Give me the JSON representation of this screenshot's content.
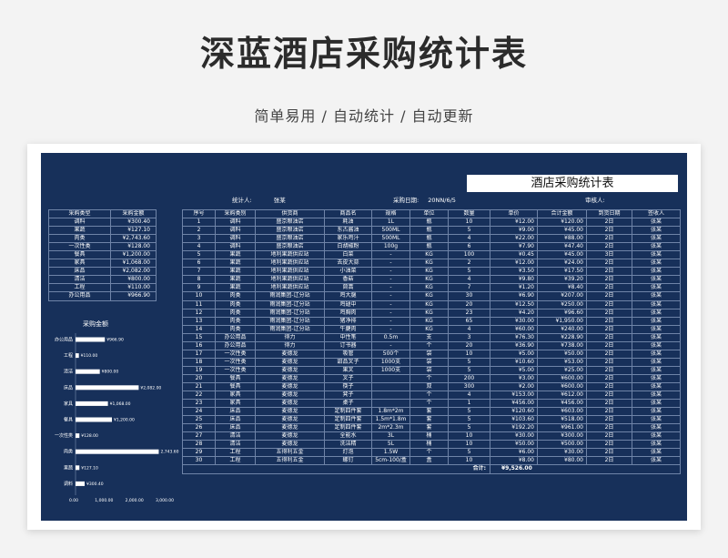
{
  "page": {
    "title": "深蓝酒店采购统计表",
    "subtitle": "简单易用 / 自动统计 / 自动更新"
  },
  "sheet": {
    "title": "酒店采购统计表",
    "stat_label": "统计人:",
    "stat_value": "张某",
    "date_label": "采购日期:",
    "date_value": "20NN/6/5",
    "reviewer_label": "审核人:"
  },
  "summary": {
    "headers": [
      "采购类型",
      "采购金额"
    ],
    "rows": [
      [
        "调料",
        "¥300.40"
      ],
      [
        "果蔬",
        "¥127.10"
      ],
      [
        "肉类",
        "¥2,743.60"
      ],
      [
        "一次性类",
        "¥128.00"
      ],
      [
        "餐具",
        "¥1,200.00"
      ],
      [
        "家具",
        "¥1,068.00"
      ],
      [
        "床品",
        "¥2,082.00"
      ],
      [
        "清洁",
        "¥800.00"
      ],
      [
        "工程",
        "¥110.00"
      ],
      [
        "办公用品",
        "¥966.90"
      ]
    ]
  },
  "chart_data": {
    "type": "bar",
    "title": "采购金额",
    "orientation": "horizontal",
    "categories": [
      "办公用品",
      "工程",
      "清洁",
      "床品",
      "家具",
      "餐具",
      "一次性类",
      "肉类",
      "果蔬",
      "调料"
    ],
    "values": [
      966.9,
      110.0,
      800.0,
      2082.0,
      1068.0,
      1200.0,
      128.0,
      2743.6,
      127.1,
      300.4
    ],
    "value_labels": [
      "¥966.90",
      "¥110.00",
      "¥800.00",
      "¥2,082.00",
      "¥1,068.00",
      "¥1,200.00",
      "¥128.00",
      "2,743.60",
      "¥127.10",
      "¥300.40"
    ],
    "tick_labels": [
      "0.00",
      "1,000.00",
      "2,000.00",
      "3,000.00"
    ],
    "xlim": [
      0,
      3000
    ]
  },
  "main": {
    "headers": [
      "序号",
      "采购类别",
      "供货商",
      "商品名",
      "规格",
      "单位",
      "数量",
      "单价",
      "合计金额",
      "到货日期",
      "签收人"
    ],
    "rows": [
      [
        "1",
        "调料",
        "盛京粮油店",
        "耗油",
        "1L",
        "瓶",
        "10",
        "¥12.00",
        "¥120.00",
        "2日",
        "张某"
      ],
      [
        "2",
        "调料",
        "盛京粮油店",
        "东古酱油",
        "500ML",
        "瓶",
        "5",
        "¥9.00",
        "¥45.00",
        "2日",
        "张某"
      ],
      [
        "3",
        "调料",
        "盛京粮油店",
        "家乐鸡汁",
        "500ML",
        "瓶",
        "4",
        "¥22.00",
        "¥88.00",
        "2日",
        "张某"
      ],
      [
        "4",
        "调料",
        "盛京粮油店",
        "白胡椒粉",
        "100g",
        "瓶",
        "6",
        "¥7.90",
        "¥47.40",
        "2日",
        "张某"
      ],
      [
        "5",
        "果蔬",
        "地利果蔬供应站",
        "白菜",
        "-",
        "KG",
        "100",
        "¥0.45",
        "¥45.00",
        "3日",
        "张某"
      ],
      [
        "6",
        "果蔬",
        "地利果蔬供应站",
        "去皮大蒜",
        "-",
        "KG",
        "2",
        "¥12.00",
        "¥24.00",
        "2日",
        "张某"
      ],
      [
        "7",
        "果蔬",
        "地利果蔬供应站",
        "小油菜",
        "-",
        "KG",
        "5",
        "¥3.50",
        "¥17.50",
        "2日",
        "张某"
      ],
      [
        "8",
        "果蔬",
        "地利果蔬供应站",
        "香菇",
        "-",
        "KG",
        "4",
        "¥9.80",
        "¥39.20",
        "2日",
        "张某"
      ],
      [
        "9",
        "果蔬",
        "地利果蔬供应站",
        "茼蒿",
        "-",
        "KG",
        "7",
        "¥1.20",
        "¥8.40",
        "2日",
        "张某"
      ],
      [
        "10",
        "肉类",
        "雨润集团-辽分站",
        "鸡大腿",
        "-",
        "KG",
        "30",
        "¥6.90",
        "¥207.00",
        "2日",
        "张某"
      ],
      [
        "11",
        "肉类",
        "雨润集团-辽分站",
        "鸡翅中",
        "-",
        "KG",
        "20",
        "¥12.50",
        "¥250.00",
        "2日",
        "张某"
      ],
      [
        "12",
        "肉类",
        "雨润集团-辽分站",
        "鸡胸肉",
        "-",
        "KG",
        "23",
        "¥4.20",
        "¥96.60",
        "2日",
        "张某"
      ],
      [
        "13",
        "肉类",
        "雨润集团-辽分站",
        "猪净排",
        "-",
        "KG",
        "65",
        "¥30.00",
        "¥1,950.00",
        "2日",
        "张某"
      ],
      [
        "14",
        "肉类",
        "雨润集团-辽分站",
        "牛腱肉",
        "-",
        "KG",
        "4",
        "¥60.00",
        "¥240.00",
        "2日",
        "张某"
      ],
      [
        "15",
        "办公用品",
        "得力",
        "中性笔",
        "0.5m",
        "支",
        "3",
        "¥76.30",
        "¥228.90",
        "2日",
        "张某"
      ],
      [
        "16",
        "办公用品",
        "得力",
        "订书器",
        "-",
        "个",
        "20",
        "¥36.90",
        "¥738.00",
        "2日",
        "张某"
      ],
      [
        "17",
        "一次性类",
        "麦德龙",
        "吸管",
        "500个",
        "袋",
        "10",
        "¥5.00",
        "¥50.00",
        "2日",
        "张某"
      ],
      [
        "18",
        "一次性类",
        "麦德龙",
        "甜品叉子",
        "1000支",
        "袋",
        "5",
        "¥10.60",
        "¥53.00",
        "2日",
        "张某"
      ],
      [
        "19",
        "一次性类",
        "麦德龙",
        "果叉",
        "1000支",
        "袋",
        "5",
        "¥5.00",
        "¥25.00",
        "2日",
        "张某"
      ],
      [
        "20",
        "餐具",
        "麦德龙",
        "叉子",
        "",
        "个",
        "200",
        "¥3.00",
        "¥600.00",
        "2日",
        "张某"
      ],
      [
        "21",
        "餐具",
        "麦德龙",
        "筷子",
        "",
        "双",
        "300",
        "¥2.00",
        "¥600.00",
        "2日",
        "张某"
      ],
      [
        "22",
        "家具",
        "麦德龙",
        "凳子",
        "",
        "个",
        "4",
        "¥153.00",
        "¥612.00",
        "2日",
        "张某"
      ],
      [
        "23",
        "家具",
        "麦德龙",
        "桌子",
        "",
        "个",
        "1",
        "¥456.00",
        "¥456.00",
        "2日",
        "张某"
      ],
      [
        "24",
        "床品",
        "麦德龙",
        "定制四件套",
        "1.8m*2m",
        "套",
        "5",
        "¥120.60",
        "¥603.00",
        "2日",
        "张某"
      ],
      [
        "25",
        "床品",
        "麦德龙",
        "定制四件套",
        "1.5m*1.8m",
        "套",
        "5",
        "¥103.60",
        "¥518.00",
        "2日",
        "张某"
      ],
      [
        "26",
        "床品",
        "麦德龙",
        "定制四件套",
        "2m*2.3m",
        "套",
        "5",
        "¥192.20",
        "¥961.00",
        "2日",
        "张某"
      ],
      [
        "27",
        "清洁",
        "麦德龙",
        "全能水",
        "3L",
        "桶",
        "10",
        "¥30.00",
        "¥300.00",
        "2日",
        "张某"
      ],
      [
        "28",
        "清洁",
        "麦德龙",
        "洗洁精",
        "5L",
        "桶",
        "10",
        "¥50.00",
        "¥500.00",
        "2日",
        "张某"
      ],
      [
        "29",
        "工程",
        "五得利五金",
        "灯泡",
        "1.5W",
        "个",
        "5",
        "¥6.00",
        "¥30.00",
        "2日",
        "张某"
      ],
      [
        "30",
        "工程",
        "五得利五金",
        "螺钉",
        "5cm-100/盒",
        "盒",
        "10",
        "¥8.00",
        "¥80.00",
        "2日",
        "张某"
      ]
    ],
    "total_label": "合计:",
    "total_value": "¥9,526.00"
  }
}
